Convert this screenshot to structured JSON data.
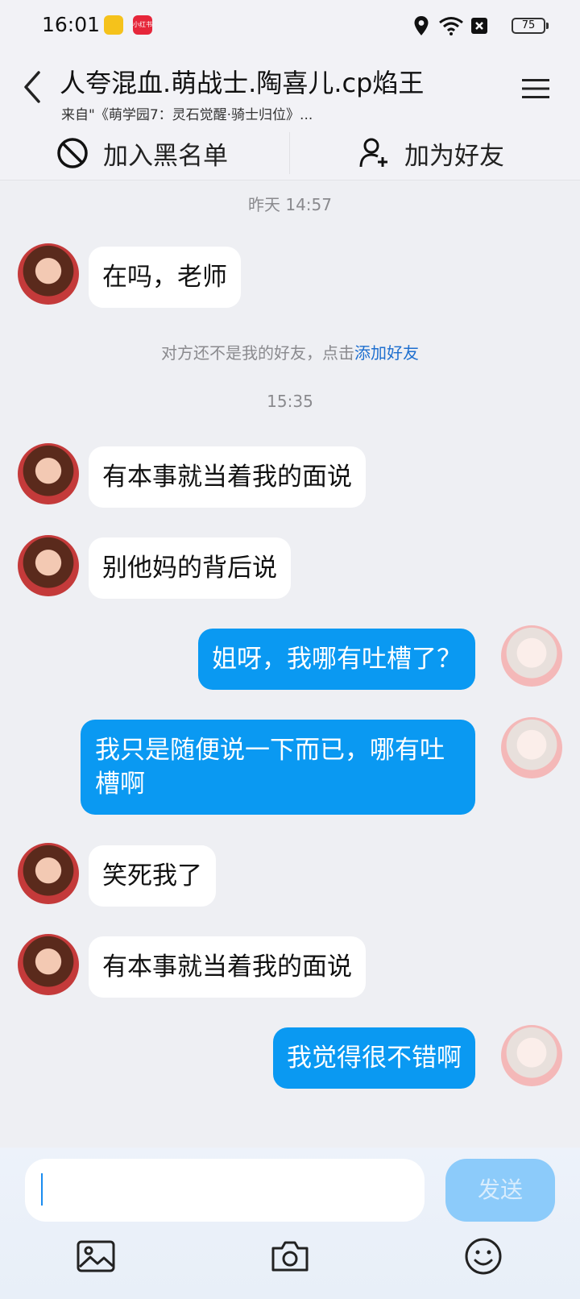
{
  "status": {
    "time": "16:01",
    "battery": "75",
    "red_badge": "小红书"
  },
  "header": {
    "title": "人夸混血.萌战士.陶喜儿.cp焰王",
    "subtitle": "来自\"《萌学园7：灵石觉醒·骑士归位》..."
  },
  "actions": {
    "block": "加入黑名单",
    "add_friend": "加为好友"
  },
  "chat": {
    "timestamps": [
      "昨天 14:57",
      "15:35"
    ],
    "system_note": {
      "text": "对方还不是我的好友，点击",
      "link": "添加好友"
    },
    "messages": [
      {
        "from": "other",
        "text": "在吗，老师"
      },
      {
        "from": "other",
        "text": "有本事就当着我的面说"
      },
      {
        "from": "other",
        "text": "别他妈的背后说"
      },
      {
        "from": "me",
        "text": "姐呀，我哪有吐槽了？"
      },
      {
        "from": "me",
        "text": "我只是随便说一下而已，哪有吐槽啊"
      },
      {
        "from": "other",
        "text": "笑死我了"
      },
      {
        "from": "other",
        "text": "有本事就当着我的面说"
      },
      {
        "from": "me",
        "text": "我觉得很不错啊"
      }
    ]
  },
  "composer": {
    "placeholder": "",
    "send_label": "发送"
  },
  "colors": {
    "outgoing_bubble": "#0a99f2",
    "incoming_bubble": "#ffffff",
    "link": "#1e6fcf"
  }
}
